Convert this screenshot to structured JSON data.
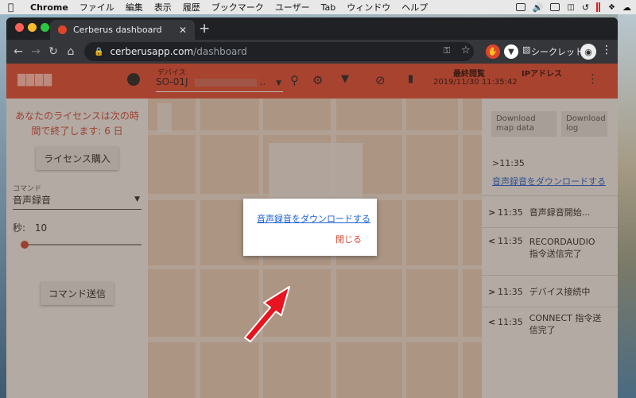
{
  "mac_menubar": {
    "app_name": "Chrome",
    "items": [
      "ファイル",
      "編集",
      "表示",
      "履歴",
      "ブックマーク",
      "ユーザー",
      "Tab",
      "ウィンドウ",
      "ヘルプ"
    ]
  },
  "browser": {
    "tab_title": "Cerberus dashboard",
    "url_domain": "cerberusapp.com",
    "url_path": "/dashboard",
    "profile_label": "シークレット"
  },
  "appbar": {
    "device_label": "デバイス",
    "device_value": "SO-01J",
    "last_seen_label": "最終閲覧",
    "last_seen_value": "2019/11/30 11:35:42",
    "ip_label": "IPアドレス"
  },
  "left_panel": {
    "license_text": "あなたのライセンスは次の時間で終了します: 6 日",
    "buy_license_button": "ライセンス購入",
    "command_label": "コマンド",
    "command_value": "音声録音",
    "seconds_label": "秒:",
    "seconds_value": "10",
    "send_command_button": "コマンド送信"
  },
  "right_panel": {
    "download_map_button": "Download map data",
    "download_log_button": "Download log",
    "log": [
      {
        "time": "11:35",
        "text": "音声録音をダウンロードする"
      },
      {
        "time": "11:35",
        "text": "音声録音開始..."
      },
      {
        "time": "11:35",
        "text": "RECORDAUDIO 指令送信完了"
      },
      {
        "time": "11:35",
        "text": "デバイス接続中"
      },
      {
        "time": "11:35",
        "text": "CONNECT 指令送信完了"
      }
    ]
  },
  "modal": {
    "download_link": "音声録音をダウンロードする",
    "close_button": "閉じる"
  },
  "colors": {
    "brand_red": "#d64530",
    "link_blue": "#1a5fd6"
  }
}
